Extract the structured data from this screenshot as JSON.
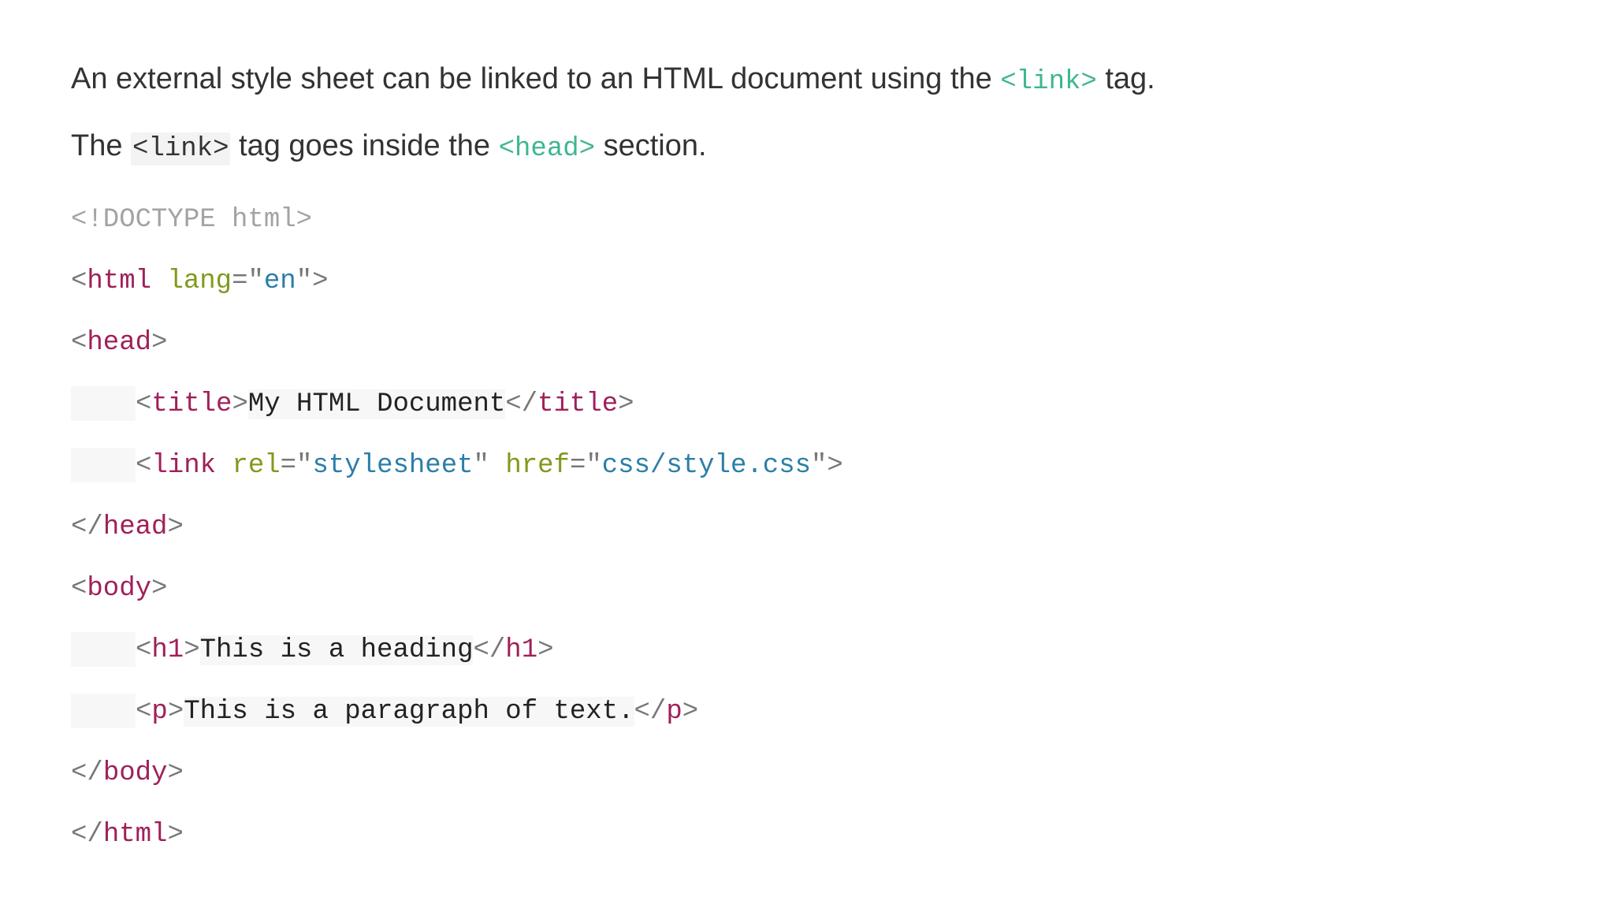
{
  "intro": {
    "line1_before": "An external style sheet can be linked to an HTML document using the ",
    "line1_code": "<link>",
    "line1_after": " tag.",
    "line2_before": "The ",
    "line2_code1": "<link>",
    "line2_middle": " tag goes inside the ",
    "line2_code2": "<head>",
    "line2_after": " section."
  },
  "code": {
    "doctype": "<!DOCTYPE html>",
    "html_tag": "html",
    "html_attr": "lang",
    "html_attr_val": "en",
    "head_tag": "head",
    "title_tag": "title",
    "title_text": "My HTML Document",
    "link_tag": "link",
    "link_rel_attr": "rel",
    "link_rel_val": "stylesheet",
    "link_href_attr": "href",
    "link_href_val": "css/style.css",
    "body_tag": "body",
    "h1_tag": "h1",
    "h1_text": "This is a heading",
    "p_tag": "p",
    "p_text": "This is a paragraph of text."
  },
  "colors": {
    "body_text": "#333333",
    "inline_code": "#3db692",
    "tag_name": "#a0205a",
    "attr_name": "#7f9a1c",
    "attr_value": "#2b7ea8",
    "doctype": "#a3a3a3"
  }
}
